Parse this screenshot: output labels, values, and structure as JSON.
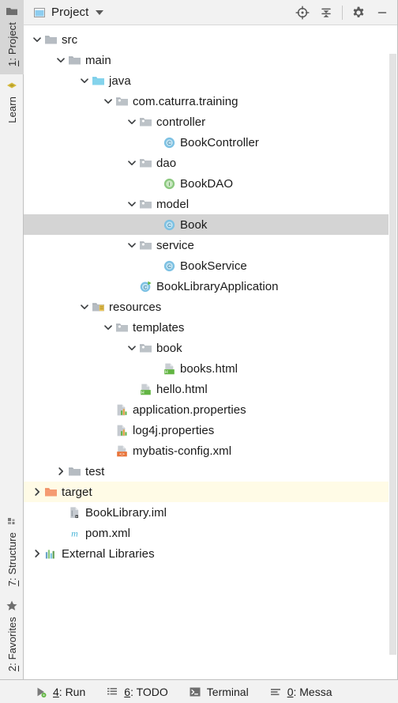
{
  "window": {
    "tool_window_title": "Project",
    "title_icon": "project-window-icon",
    "dropdown_icon": "chevron-down-icon"
  },
  "toolbar": {
    "actions": [
      {
        "name": "locate-icon",
        "label": "Select Opened File"
      },
      {
        "name": "collapse-all-icon",
        "label": "Collapse All"
      },
      {
        "name": "gear-icon",
        "label": "Settings"
      },
      {
        "name": "minimize-icon",
        "label": "Hide"
      }
    ]
  },
  "left_rail": {
    "top": [
      {
        "label_prefix": "1",
        "label": ": Project",
        "icon": "project-folder-icon",
        "active": true
      },
      {
        "label_prefix": "",
        "label": "Learn",
        "icon": "learn-icon",
        "active": false
      }
    ],
    "bottom": [
      {
        "label_prefix": "7",
        "label": ": Structure",
        "icon": "structure-grid-icon",
        "active": false
      },
      {
        "label_prefix": "2",
        "label": ": Favorites",
        "icon": "star-icon",
        "active": false
      }
    ]
  },
  "tree": {
    "nodes": [
      {
        "label": "src",
        "indent": 1,
        "icon": "folder-icon",
        "twisty": "expanded"
      },
      {
        "label": "main",
        "indent": 2,
        "icon": "folder-icon",
        "twisty": "expanded"
      },
      {
        "label": "java",
        "indent": 3,
        "icon": "source-folder-icon",
        "twisty": "expanded"
      },
      {
        "label": "com.caturra.training",
        "indent": 4,
        "icon": "package-icon",
        "twisty": "expanded"
      },
      {
        "label": "controller",
        "indent": 5,
        "icon": "package-icon",
        "twisty": "expanded"
      },
      {
        "label": "BookController",
        "indent": 6,
        "icon": "java-class-icon",
        "twisty": "none"
      },
      {
        "label": "dao",
        "indent": 5,
        "icon": "package-icon",
        "twisty": "expanded"
      },
      {
        "label": "BookDAO",
        "indent": 6,
        "icon": "java-interface-icon",
        "twisty": "none"
      },
      {
        "label": "model",
        "indent": 5,
        "icon": "package-icon",
        "twisty": "expanded"
      },
      {
        "label": "Book",
        "indent": 6,
        "icon": "java-class-icon",
        "twisty": "none",
        "state": "selected"
      },
      {
        "label": "service",
        "indent": 5,
        "icon": "package-icon",
        "twisty": "expanded"
      },
      {
        "label": "BookService",
        "indent": 6,
        "icon": "java-class-icon",
        "twisty": "none"
      },
      {
        "label": "BookLibraryApplication",
        "indent": 5,
        "icon": "java-runnable-class-icon",
        "twisty": "none"
      },
      {
        "label": "resources",
        "indent": 3,
        "icon": "resource-folder-icon",
        "twisty": "expanded"
      },
      {
        "label": "templates",
        "indent": 4,
        "icon": "package-icon",
        "twisty": "expanded"
      },
      {
        "label": "book",
        "indent": 5,
        "icon": "package-icon",
        "twisty": "expanded"
      },
      {
        "label": "books.html",
        "indent": 6,
        "icon": "html-file-icon",
        "twisty": "none"
      },
      {
        "label": "hello.html",
        "indent": 5,
        "icon": "html-file-icon",
        "twisty": "none"
      },
      {
        "label": "application.properties",
        "indent": 4,
        "icon": "properties-file-icon",
        "twisty": "none"
      },
      {
        "label": "log4j.properties",
        "indent": 4,
        "icon": "properties-file-icon",
        "twisty": "none"
      },
      {
        "label": "mybatis-config.xml",
        "indent": 4,
        "icon": "xml-file-icon",
        "twisty": "none"
      },
      {
        "label": "test",
        "indent": 2,
        "icon": "folder-icon",
        "twisty": "collapsed"
      },
      {
        "label": "target",
        "indent": 1,
        "icon": "excluded-folder-icon",
        "twisty": "collapsed",
        "state": "excluded"
      },
      {
        "label": "BookLibrary.iml",
        "indent": 2,
        "icon": "iml-file-icon",
        "twisty": "none"
      },
      {
        "label": "pom.xml",
        "indent": 2,
        "icon": "maven-file-icon",
        "twisty": "none"
      },
      {
        "label": "External Libraries",
        "indent": 1,
        "icon": "libraries-icon",
        "twisty": "collapsed"
      }
    ]
  },
  "statusbar": {
    "buttons": [
      {
        "prefix": "4",
        "label": ": Run",
        "icon": "run-icon"
      },
      {
        "prefix": "6",
        "label": ": TODO",
        "icon": "todo-list-icon"
      },
      {
        "prefix": "",
        "label": "Terminal",
        "icon": "terminal-icon"
      },
      {
        "prefix": "0",
        "label": ": Messa",
        "icon": "messages-icon"
      }
    ]
  },
  "colors": {
    "selection": "#d4d4d4",
    "excluded_row": "#fffbe6",
    "class_icon": "#6fb6e0",
    "interface_icon": "#85c47f",
    "source_folder": "#7ccdea",
    "excluded_folder": "#f08a5d",
    "maven": "#5bbedc",
    "html_badge": "#5aab48",
    "xml_badge": "#e8743b",
    "toolwindow_bg": "#f2f2f2"
  }
}
